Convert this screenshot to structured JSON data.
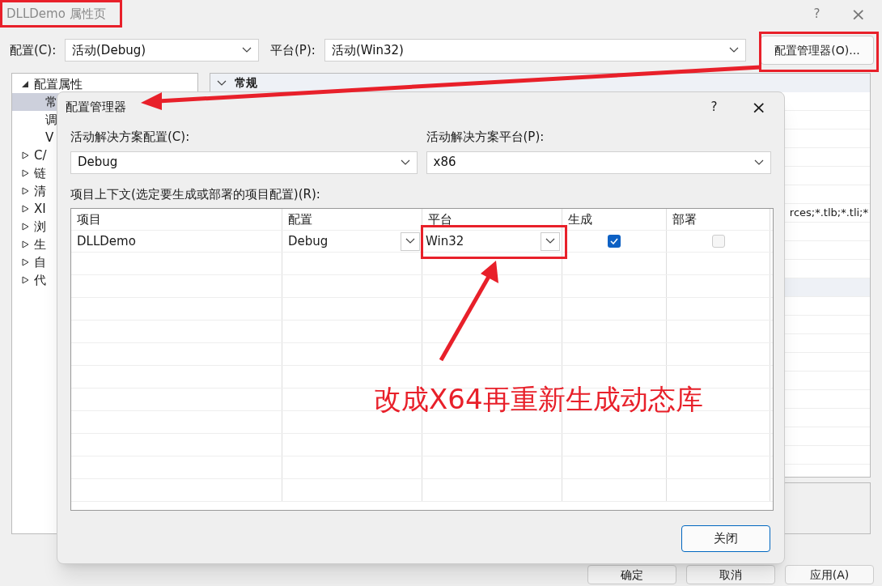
{
  "window": {
    "title": "DLLDemo 属性页",
    "help": "?",
    "close": "×"
  },
  "toolbar": {
    "config_label": "配置(C):",
    "config_value": "活动(Debug)",
    "platform_label": "平台(P):",
    "platform_value": "活动(Win32)",
    "manager_button": "配置管理器(O)..."
  },
  "tree": [
    {
      "label": "配置属性",
      "expanded": true,
      "children": [
        {
          "label": "常",
          "selected": true
        },
        {
          "label": "调",
          "selected": false
        },
        {
          "label": "V",
          "selected": false
        }
      ]
    },
    {
      "label": "C/",
      "expanded": false
    },
    {
      "label": "链",
      "expanded": false
    },
    {
      "label": "清",
      "expanded": false
    },
    {
      "label": "XI",
      "expanded": false
    },
    {
      "label": "浏",
      "expanded": false
    },
    {
      "label": "生",
      "expanded": false
    },
    {
      "label": "自",
      "expanded": false
    },
    {
      "label": "代",
      "expanded": false
    }
  ],
  "property_grid": {
    "section": "常规",
    "value_text": "rces;*.tlb;*.tli;*"
  },
  "footer_buttons": [
    "确定",
    "取消",
    "应用(A)"
  ],
  "dialog": {
    "title": "配置管理器",
    "help": "?",
    "close": "×",
    "solution_config_label": "活动解决方案配置(C):",
    "solution_config_value": "Debug",
    "solution_platform_label": "活动解决方案平台(P):",
    "solution_platform_value": "x86",
    "context_label": "项目上下文(选定要生成或部署的项目配置)(R):",
    "table": {
      "columns": [
        "项目",
        "配置",
        "平台",
        "生成",
        "部署"
      ],
      "rows": [
        {
          "project": "DLLDemo",
          "configuration": "Debug",
          "platform": "Win32",
          "build": true,
          "deploy": false
        }
      ]
    },
    "close_button": "关闭"
  },
  "annotation": {
    "text": "改成X64再重新生成动态库"
  }
}
